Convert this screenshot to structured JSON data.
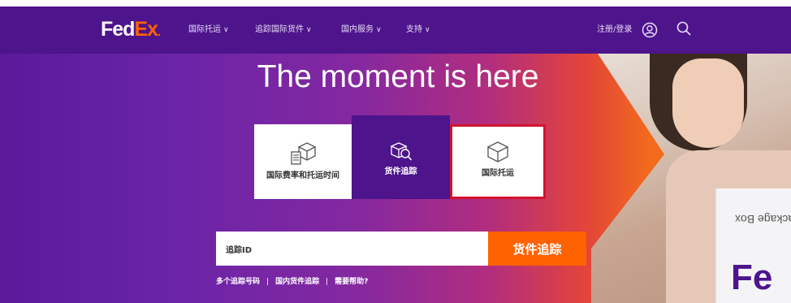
{
  "brand": {
    "fed": "Fed",
    "ex": "Ex",
    "dot": "."
  },
  "nav": {
    "items": [
      {
        "label": "国际托运",
        "chev": "∨"
      },
      {
        "label": "追踪国际货件",
        "chev": "∨"
      },
      {
        "label": "国内服务",
        "chev": "∨"
      },
      {
        "label": "支持",
        "chev": "∨"
      }
    ],
    "login": "注册/登录"
  },
  "hero": {
    "headline": "The moment is here",
    "tiles": [
      {
        "label": "国际费率和托运时间",
        "icon": "rate-box-icon"
      },
      {
        "label": "货件追踪",
        "icon": "track-search-icon"
      },
      {
        "label": "国际托运",
        "icon": "package-box-icon"
      }
    ],
    "tracking": {
      "placeholder": "追踪ID",
      "button": "货件追踪"
    },
    "links": [
      "多个追踪号码",
      "国内货件追踪",
      "需要帮助?"
    ],
    "photo_box_text": "Package Box",
    "photo_box_brand": "Fe"
  },
  "colors": {
    "purple": "#4d148c",
    "orange": "#ff6200",
    "highlight": "#d4122f"
  }
}
